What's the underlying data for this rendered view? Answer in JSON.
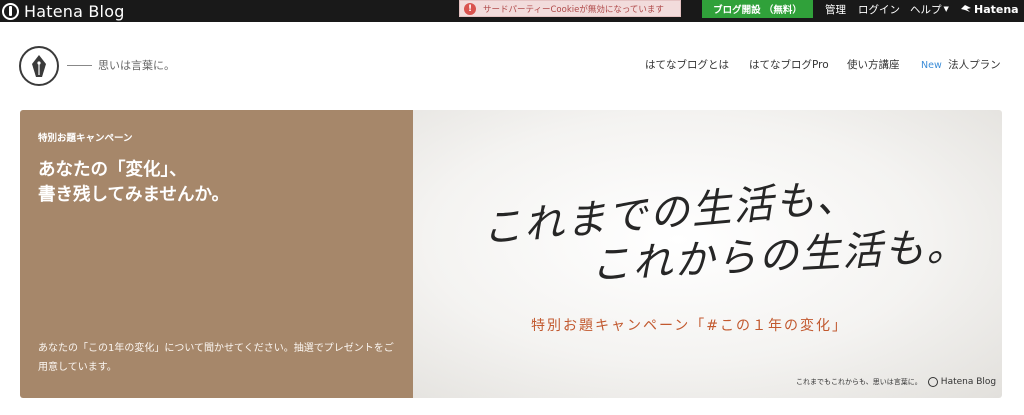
{
  "topbar": {
    "brand": "Hatena Blog",
    "cookie_warning": "サードパーティーCookieが無効になっています",
    "open_blog_button": "ブログ開設 （無料）",
    "admin": "管理",
    "login": "ログイン",
    "help": "ヘルプ",
    "hatena": "Hatena"
  },
  "header": {
    "tagline": "思いは言葉に。",
    "nav": {
      "about": "はてなブログとは",
      "pro": "はてなブログPro",
      "guide": "使い方講座",
      "new_badge": "New",
      "corporate": "法人プラン"
    }
  },
  "campaign": {
    "label": "特別お題キャンペーン",
    "title_line1": "あなたの「変化」、",
    "title_line2": "書き残してみませんか。",
    "description": "あなたの「この1年の変化」について聞かせてください。抽選でプレゼントをご用意しています。",
    "image": {
      "line1": "これまでの生活も、",
      "line2": "これからの生活も。",
      "hashtag": "特別お題キャンペーン「#この１年の変化」",
      "footer_text": "これまでもこれからも、思いは言葉に。",
      "footer_brand": "Hatena Blog"
    }
  },
  "colors": {
    "topbar_bg": "#191919",
    "open_blog_green": "#30a13a",
    "campaign_brown": "#a6876a",
    "hashtag_orange": "#c2592f",
    "new_badge_blue": "#3d8ed8"
  }
}
